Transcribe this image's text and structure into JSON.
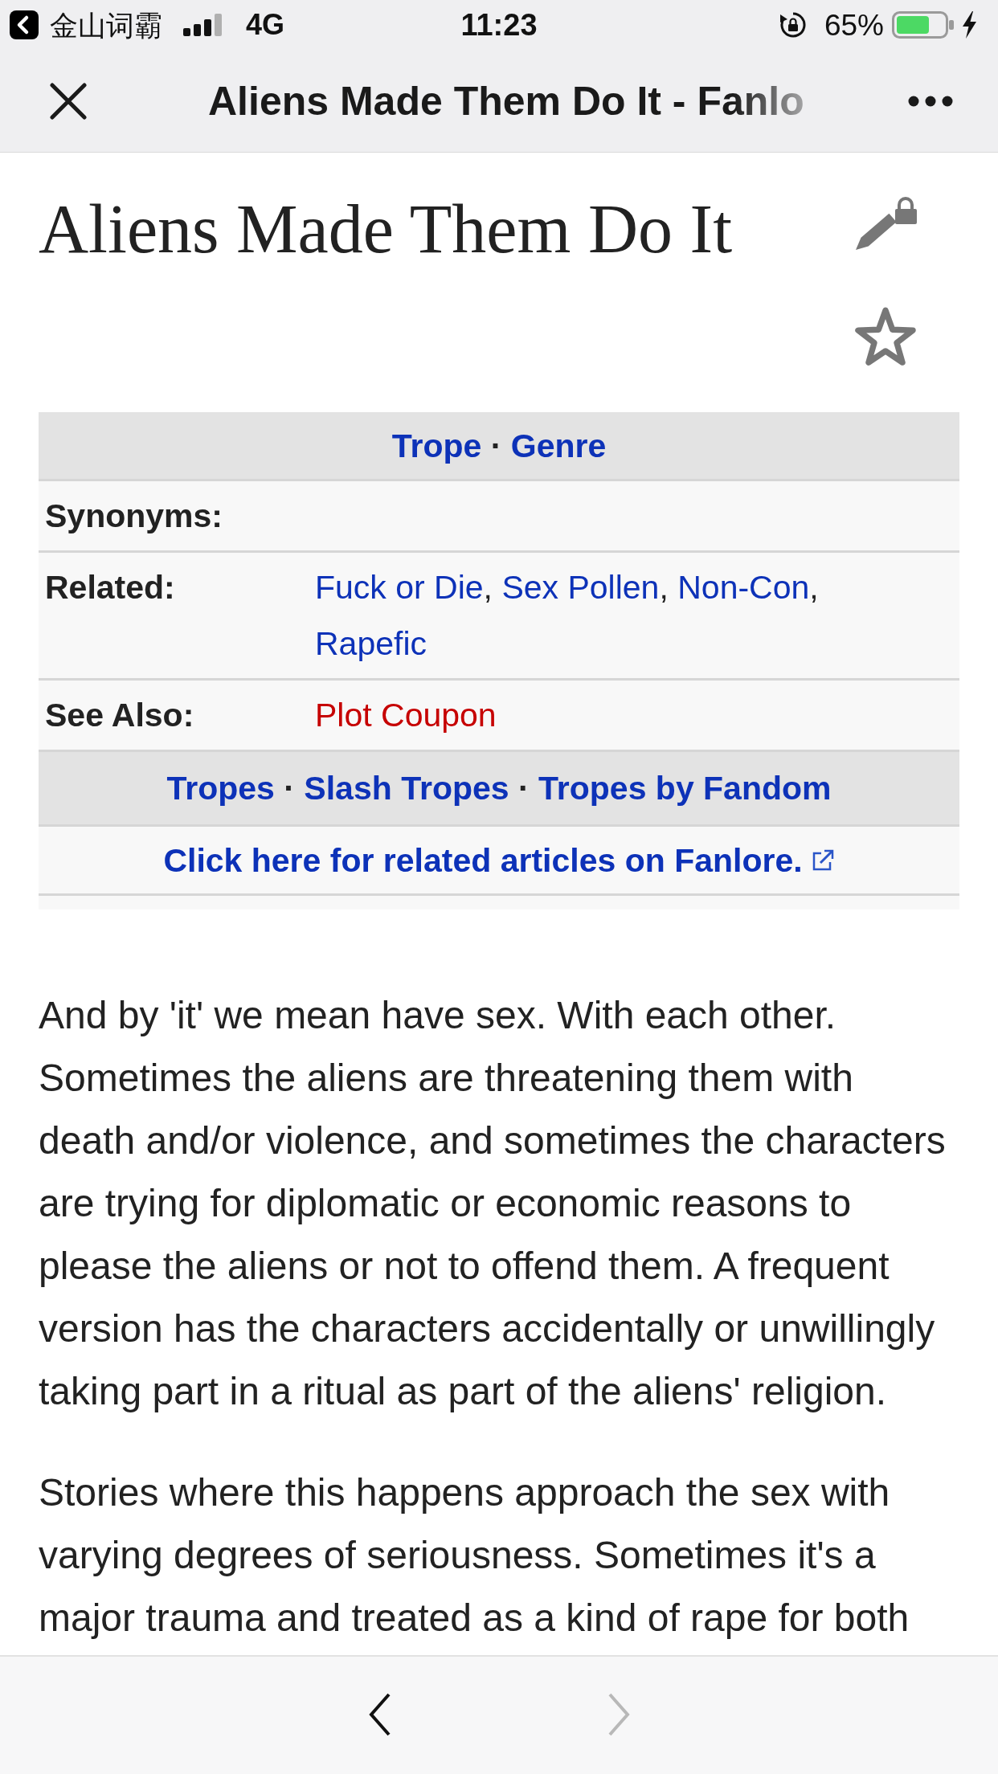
{
  "status_bar": {
    "back_to_app": "金山词霸",
    "network": "4G",
    "time": "11:23",
    "battery": "65%",
    "orientation_lock": true,
    "charging": true
  },
  "nav_bar": {
    "title": "Aliens Made Them Do It - Fanlo"
  },
  "article": {
    "title": "Aliens Made Them Do It",
    "edit_locked": true,
    "watched": false,
    "infobox": {
      "header": {
        "links": [
          "Trope",
          "Genre"
        ],
        "separator": "·"
      },
      "rows": [
        {
          "label": "Synonyms:"
        },
        {
          "label": "Related:",
          "links": [
            {
              "text": "Fuck or Die",
              "missing": false
            },
            {
              "text": "Sex Pollen",
              "missing": false
            },
            {
              "text": "Non-Con",
              "missing": false
            },
            {
              "text": "Rapefic",
              "missing": false
            }
          ],
          "separator": ","
        },
        {
          "label": "See Also:",
          "links": [
            {
              "text": "Plot Coupon",
              "missing": true
            }
          ]
        }
      ],
      "footer": {
        "links": [
          "Tropes",
          "Slash Tropes",
          "Tropes by Fandom"
        ],
        "separator": "·"
      },
      "external_link": "Click here for related articles on Fanlore."
    },
    "paragraphs": [
      "And by 'it' we mean have sex. With each other. Sometimes the aliens are threatening them with death and/or violence, and sometimes the characters are trying for diplomatic or economic reasons to please the aliens or not to offend them. A frequent version has the characters accidentally or unwillingly taking part in a ritual as part of the aliens' religion.",
      "Stories where this happens approach the sex with varying degrees of seriousness. Sometimes it's a major trauma and treated as a kind of rape for both"
    ]
  },
  "toolbar": {
    "back": {
      "disabled": false
    },
    "forward": {
      "disabled": true
    }
  }
}
